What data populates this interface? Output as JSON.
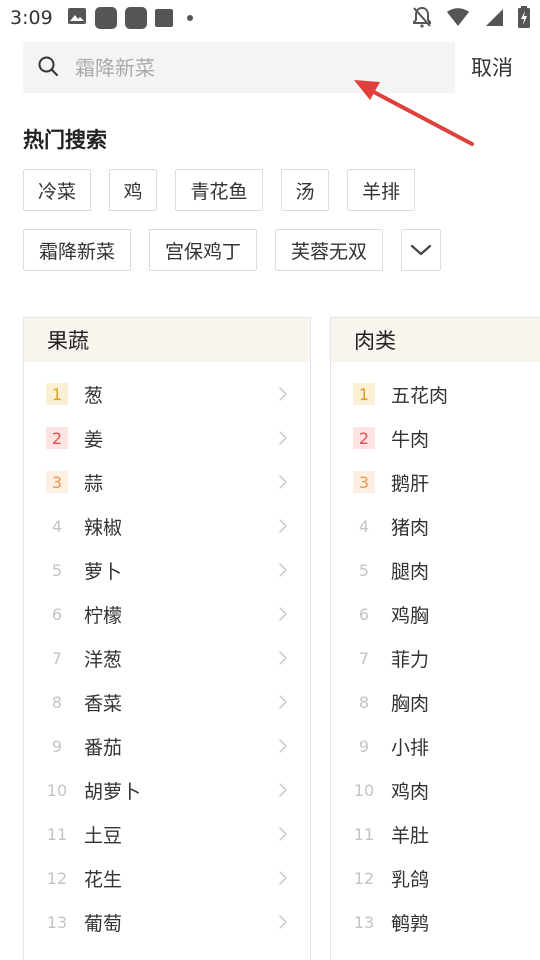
{
  "status_bar": {
    "time": "3:09",
    "icons_left": [
      "image-icon",
      "app-square-icon",
      "app-square-icon",
      "stop-square-icon",
      "dot-icon"
    ],
    "icons_right": [
      "notification-off-icon",
      "wifi-icon",
      "signal-icon",
      "battery-icon"
    ]
  },
  "search": {
    "placeholder": "霜降新菜",
    "value": "",
    "cancel_label": "取消"
  },
  "hot_search": {
    "title": "热门搜索",
    "tags": [
      "冷菜",
      "鸡",
      "青花鱼",
      "汤",
      "羊排",
      "霜降新菜",
      "宫保鸡丁",
      "芙蓉无双"
    ],
    "more_icon": "chevron-down-icon"
  },
  "categories": [
    {
      "title": "果蔬",
      "items": [
        {
          "rank": "1",
          "name": "葱"
        },
        {
          "rank": "2",
          "name": "姜"
        },
        {
          "rank": "3",
          "name": "蒜"
        },
        {
          "rank": "4",
          "name": "辣椒"
        },
        {
          "rank": "5",
          "name": "萝卜"
        },
        {
          "rank": "6",
          "name": "柠檬"
        },
        {
          "rank": "7",
          "name": "洋葱"
        },
        {
          "rank": "8",
          "name": "香菜"
        },
        {
          "rank": "9",
          "name": "番茄"
        },
        {
          "rank": "10",
          "name": "胡萝卜"
        },
        {
          "rank": "11",
          "name": "土豆"
        },
        {
          "rank": "12",
          "name": "花生"
        },
        {
          "rank": "13",
          "name": "葡萄"
        }
      ]
    },
    {
      "title": "肉类",
      "items": [
        {
          "rank": "1",
          "name": "五花肉"
        },
        {
          "rank": "2",
          "name": "牛肉"
        },
        {
          "rank": "3",
          "name": "鹅肝"
        },
        {
          "rank": "4",
          "name": "猪肉"
        },
        {
          "rank": "5",
          "name": "腿肉"
        },
        {
          "rank": "6",
          "name": "鸡胸"
        },
        {
          "rank": "7",
          "name": "菲力"
        },
        {
          "rank": "8",
          "name": "胸肉"
        },
        {
          "rank": "9",
          "name": "小排"
        },
        {
          "rank": "10",
          "name": "鸡肉"
        },
        {
          "rank": "11",
          "name": "羊肚"
        },
        {
          "rank": "12",
          "name": "乳鸽"
        },
        {
          "rank": "13",
          "name": "鹌鹑"
        }
      ]
    }
  ],
  "colors": {
    "accent_arrow": "#e0403c",
    "rank1": "#d8a31d",
    "rank2": "#e2504a",
    "rank3": "#e49a4d",
    "panel_header_bg": "#f8f4ee"
  }
}
